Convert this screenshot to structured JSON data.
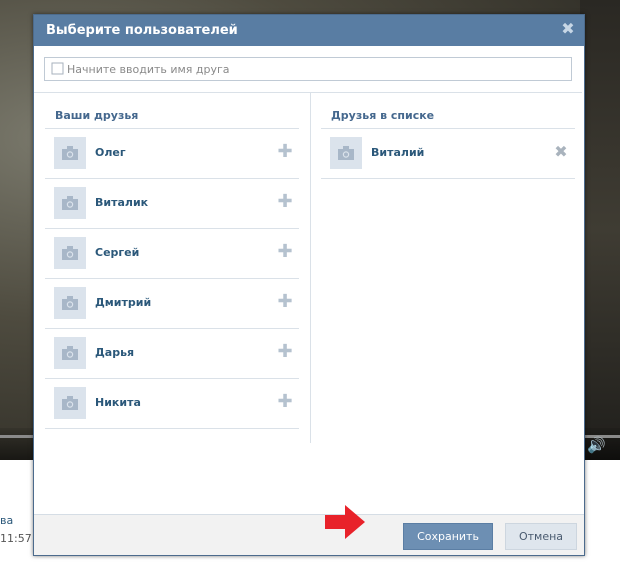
{
  "background": {
    "text_a": "ва",
    "text_b": "11:57"
  },
  "modal": {
    "title": "Выберите пользователей",
    "close_icon": "close-icon",
    "search": {
      "placeholder": "Начните вводить имя друга"
    },
    "left_column": {
      "title": "Ваши друзья",
      "items": [
        {
          "name": "Олег"
        },
        {
          "name": "Виталик"
        },
        {
          "name": "Сергей"
        },
        {
          "name": "Дмитрий"
        },
        {
          "name": "Дарья"
        },
        {
          "name": "Никита"
        }
      ]
    },
    "right_column": {
      "title": "Друзья в списке",
      "items": [
        {
          "name": "Виталий"
        }
      ]
    },
    "footer": {
      "save_label": "Сохранить",
      "cancel_label": "Отмена"
    }
  },
  "colors": {
    "header": "#597da3",
    "link": "#2b587a",
    "save_button": "#6d8fb3",
    "arrow": "#e8222a"
  }
}
